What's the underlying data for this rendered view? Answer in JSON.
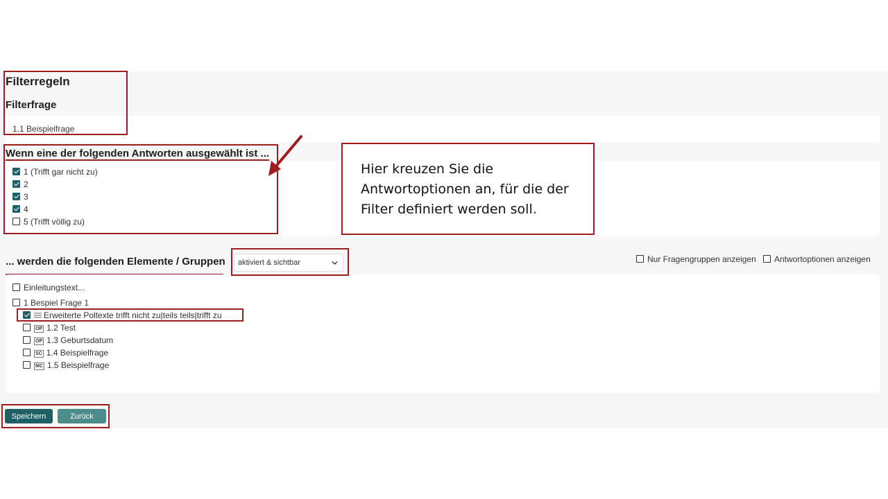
{
  "filter": {
    "title": "Filterregeln",
    "question_heading": "Filterfrage",
    "question_value": "1.1 Beispielfrage"
  },
  "answers": {
    "heading": "Wenn eine der folgenden Antworten ausgewählt ist ...",
    "options": [
      {
        "label": "1 (Trifft gar nicht zu)",
        "checked": true
      },
      {
        "label": "2",
        "checked": true
      },
      {
        "label": "3",
        "checked": true
      },
      {
        "label": "4",
        "checked": true
      },
      {
        "label": "5 (Trifft völlig zu)",
        "checked": false
      }
    ]
  },
  "elements": {
    "heading": "... werden die folgenden Elemente / Gruppen",
    "mode_select": "aktiviert & sichtbar",
    "only_groups_label": "Nur Fragengruppen anzeigen",
    "show_options_label": "Antwortoptionen anzeigen",
    "intro": "Einleitungstext...",
    "group": "1 Bespiel Frage 1",
    "items": [
      {
        "badge": "",
        "label": "Erweiterte Poltexte trifft nicht zu|teils teils|trifft zu",
        "checked": true
      },
      {
        "badge": "OP",
        "label": "1.2 Test",
        "checked": false
      },
      {
        "badge": "OP",
        "label": "1.3 Geburtsdatum",
        "checked": false
      },
      {
        "badge": "SC",
        "label": "1.4 Beispielfrage",
        "checked": false
      },
      {
        "badge": "MC",
        "label": "1.5 Beispielfrage",
        "checked": false
      }
    ]
  },
  "buttons": {
    "save": "Speichern",
    "back": "Zurück"
  },
  "callout": {
    "line1": "Hier kreuzen Sie die",
    "line2": "Antwortoptionen an, für die der",
    "line3": "Filter definiert werden soll."
  },
  "colors": {
    "annotation_red": "#a01c1c",
    "primary_button": "#1f5f66",
    "secondary_button": "#4c8c8a"
  }
}
